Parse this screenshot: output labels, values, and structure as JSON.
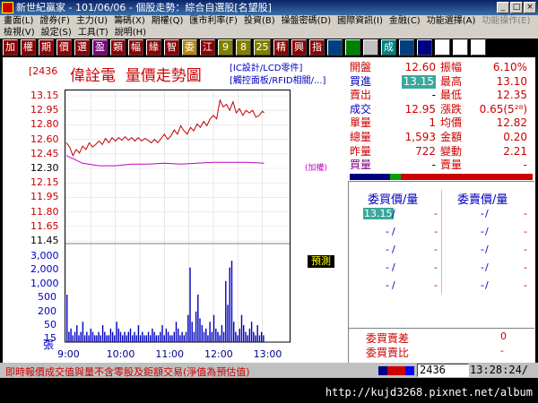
{
  "window": {
    "title": "新世紀贏家 - 101/06/06 - 個股走勢：綜合自選股[名望股]",
    "buttons": [
      "_",
      "□",
      "×"
    ]
  },
  "menu": {
    "row1": [
      {
        "label": "畫面(L)",
        "enabled": true
      },
      {
        "label": "證券(F)",
        "enabled": true
      },
      {
        "label": "主力(U)",
        "enabled": true
      },
      {
        "label": "籌碼(X)",
        "enabled": true
      },
      {
        "label": "期權(Q)",
        "enabled": true
      },
      {
        "label": "匯市利率(F)",
        "enabled": true
      },
      {
        "label": "投資(B)",
        "enabled": true
      },
      {
        "label": "操盤密碼(D)",
        "enabled": true
      },
      {
        "label": "國際資訊(I)",
        "enabled": true
      },
      {
        "label": "金融(C)",
        "enabled": true
      },
      {
        "label": "功能選擇(A)",
        "enabled": true
      },
      {
        "label": "功能操作(E)",
        "enabled": false
      }
    ],
    "row2": [
      {
        "label": "檢視(V)",
        "enabled": true
      },
      {
        "label": "設定(S)",
        "enabled": true
      },
      {
        "label": "工具(T)",
        "enabled": true
      },
      {
        "label": "說明(H)",
        "enabled": true
      }
    ]
  },
  "toolbar": {
    "buttons": [
      {
        "label": "加",
        "bg": "#8b0000",
        "fg": "#ffffff"
      },
      {
        "label": "權",
        "bg": "#8b0000",
        "fg": "#ffffff"
      },
      {
        "label": "期",
        "bg": "#8b0000",
        "fg": "#ffffff"
      },
      {
        "label": "價",
        "bg": "#8b0000",
        "fg": "#ffffff"
      },
      {
        "label": "選",
        "bg": "#8b0000",
        "fg": "#ffffff"
      },
      {
        "label": "盈",
        "bg": "#800080",
        "fg": "#ffffff"
      },
      {
        "label": "類",
        "bg": "#8b0000",
        "fg": "#ffffff"
      },
      {
        "label": "幅",
        "bg": "#8b0000",
        "fg": "#ffffff"
      },
      {
        "label": "緣",
        "bg": "#8b0000",
        "fg": "#ffffff"
      },
      {
        "label": "智",
        "bg": "#8b0000",
        "fg": "#ffffff"
      },
      {
        "label": "委",
        "bg": "#b8860b",
        "fg": "#ffffff"
      },
      {
        "label": "江",
        "bg": "#8b0000",
        "fg": "#ffffff"
      },
      {
        "label": "9",
        "bg": "#808000",
        "fg": "#ffffff"
      },
      {
        "label": "8",
        "bg": "#808000",
        "fg": "#ffffff"
      },
      {
        "label": "25",
        "bg": "#808000",
        "fg": "#ffffff"
      },
      {
        "label": "精",
        "bg": "#8b0000",
        "fg": "#ffffff"
      },
      {
        "label": "興",
        "bg": "#8b0000",
        "fg": "#ffffff"
      },
      {
        "label": "指",
        "bg": "#8b0000",
        "fg": "#ffffff"
      },
      {
        "label": "",
        "bg": "#004080",
        "fg": "#ffffff"
      },
      {
        "label": "",
        "bg": "#008000",
        "fg": "#ffffff"
      },
      {
        "label": "",
        "bg": "#c0c0c0",
        "fg": "#000000"
      },
      {
        "label": "成",
        "bg": "#008080",
        "fg": "#ffffff"
      },
      {
        "label": "",
        "bg": "#004080",
        "fg": "#ffffff"
      },
      {
        "label": "",
        "bg": "#000080",
        "fg": "#ffffff"
      },
      {
        "label": "",
        "bg": "#ffffff",
        "fg": "#000000"
      },
      {
        "label": "",
        "bg": "#ffffff",
        "fg": "#000000"
      },
      {
        "label": "",
        "bg": "#ffffff",
        "fg": "#000000"
      }
    ]
  },
  "stock": {
    "code": "[2436",
    "name": "偉詮電",
    "view": "量價走勢圖"
  },
  "info_links": [
    "[IC設計/LCD零件]",
    "[觸控面板/RFID相關/...]"
  ],
  "chart_data": {
    "type": "line",
    "x_ticks": [
      "9:00",
      "10:00",
      "11:00",
      "12:00",
      "13:00"
    ],
    "y_ticks": [
      {
        "label": "13.15",
        "kind": "up"
      },
      {
        "label": "12.95",
        "kind": "up"
      },
      {
        "label": "12.80",
        "kind": "up"
      },
      {
        "label": "12.60",
        "kind": "up"
      },
      {
        "label": "12.45",
        "kind": "up"
      },
      {
        "label": "12.30",
        "kind": "base"
      },
      {
        "label": "12.15",
        "kind": "up"
      },
      {
        "label": "11.95",
        "kind": "up"
      },
      {
        "label": "11.80",
        "kind": "up"
      },
      {
        "label": "11.65",
        "kind": "up"
      },
      {
        "label": "11.45",
        "kind": "base"
      }
    ],
    "volume_ticks": [
      "3,000",
      "2,000",
      "1,000",
      "500",
      "200",
      "50",
      "15"
    ],
    "volume_unit": "張",
    "ylim": [
      11.45,
      13.15
    ],
    "reference_label": "(加權)",
    "price_series": {
      "name": "price",
      "color": "#c00000",
      "points": [
        [
          0,
          12.6
        ],
        [
          4,
          12.55
        ],
        [
          8,
          12.45
        ],
        [
          12,
          12.52
        ],
        [
          16,
          12.48
        ],
        [
          20,
          12.56
        ],
        [
          24,
          12.52
        ],
        [
          28,
          12.6
        ],
        [
          32,
          12.55
        ],
        [
          36,
          12.58
        ],
        [
          40,
          12.62
        ],
        [
          44,
          12.58
        ],
        [
          48,
          12.65
        ],
        [
          52,
          12.6
        ],
        [
          56,
          12.66
        ],
        [
          60,
          12.62
        ],
        [
          64,
          12.66
        ],
        [
          68,
          12.63
        ],
        [
          72,
          12.67
        ],
        [
          76,
          12.63
        ],
        [
          80,
          12.66
        ],
        [
          84,
          12.62
        ],
        [
          88,
          12.66
        ],
        [
          92,
          12.62
        ],
        [
          96,
          12.65
        ],
        [
          100,
          12.63
        ],
        [
          104,
          12.6
        ],
        [
          108,
          12.64
        ],
        [
          112,
          12.6
        ],
        [
          116,
          12.65
        ],
        [
          120,
          12.7
        ],
        [
          124,
          12.64
        ],
        [
          128,
          12.68
        ],
        [
          132,
          12.75
        ],
        [
          136,
          12.7
        ],
        [
          140,
          12.8
        ],
        [
          144,
          12.74
        ],
        [
          148,
          12.7
        ],
        [
          152,
          12.78
        ],
        [
          156,
          12.74
        ],
        [
          160,
          12.82
        ],
        [
          164,
          12.78
        ],
        [
          168,
          12.85
        ],
        [
          172,
          12.8
        ],
        [
          176,
          12.88
        ],
        [
          180,
          12.92
        ],
        [
          184,
          12.88
        ],
        [
          188,
          13.1
        ],
        [
          192,
          13.02
        ],
        [
          196,
          13.05
        ],
        [
          200,
          12.98
        ],
        [
          204,
          13.08
        ],
        [
          208,
          12.95
        ],
        [
          212,
          13.0
        ],
        [
          216,
          12.92
        ],
        [
          220,
          12.98
        ],
        [
          224,
          12.95
        ],
        [
          228,
          12.98
        ],
        [
          232,
          12.9
        ],
        [
          236,
          12.92
        ],
        [
          240,
          12.97
        ],
        [
          242,
          12.95
        ]
      ]
    },
    "reference_series": {
      "name": "index",
      "color": "#c000c0",
      "points": [
        [
          0,
          12.45
        ],
        [
          20,
          12.36
        ],
        [
          40,
          12.33
        ],
        [
          60,
          12.33
        ],
        [
          80,
          12.35
        ],
        [
          100,
          12.35
        ],
        [
          120,
          12.36
        ],
        [
          140,
          12.35
        ],
        [
          160,
          12.36
        ],
        [
          180,
          12.37
        ],
        [
          200,
          12.37
        ],
        [
          220,
          12.37
        ],
        [
          242,
          12.36
        ]
      ]
    },
    "volume_series": [
      14,
      3,
      4,
      2,
      3,
      5,
      2,
      3,
      6,
      2,
      3,
      2,
      4,
      3,
      2,
      2,
      3,
      2,
      5,
      3,
      2,
      2,
      4,
      3,
      2,
      6,
      4,
      3,
      2,
      3,
      2,
      3,
      4,
      2,
      3,
      2,
      5,
      2,
      3,
      2,
      2,
      3,
      2,
      4,
      3,
      2,
      2,
      3,
      5,
      2,
      4,
      3,
      2,
      2,
      3,
      6,
      4,
      2,
      3,
      2,
      3,
      8,
      22,
      6,
      3,
      9,
      14,
      7,
      5,
      3,
      4,
      2,
      6,
      3,
      8,
      4,
      3,
      2,
      5,
      3,
      18,
      11,
      22,
      24,
      6,
      3,
      2,
      4,
      8,
      5,
      3,
      2,
      4,
      6,
      3,
      2,
      5,
      2,
      3,
      2
    ],
    "session_start": "9:00",
    "session_end": "13:30",
    "total_minutes": 270
  },
  "estimate_badge": "預測",
  "stats": [
    {
      "l": "開盤",
      "lc": "red",
      "v": "12.60",
      "l2": "振幅",
      "v2": "6.10%"
    },
    {
      "l": "買進",
      "lc": "blue",
      "v": "13.15",
      "vhl": true,
      "l2": "最高",
      "v2": "13.10"
    },
    {
      "l": "賣出",
      "lc": "red",
      "v": "-",
      "l2": "最低",
      "v2": "12.35"
    },
    {
      "l": "成交",
      "lc": "blue",
      "v": "12.95",
      "l2": "漲跌",
      "v2": "0.65(5²⁸)"
    },
    {
      "l": "單量",
      "lc": "red",
      "v": "1",
      "l2": "均價",
      "v2": "12.82"
    },
    {
      "l": "總量",
      "lc": "red",
      "v": "1,593",
      "l2": "金額",
      "v2": "0.20"
    },
    {
      "l": "昨量",
      "lc": "red",
      "v": "722",
      "l2": "變動",
      "v2": "2.21"
    },
    {
      "l": "買量",
      "lc": "purple",
      "v": "-",
      "l2": "賣量",
      "v2": "-"
    }
  ],
  "ratio_bar": [
    {
      "color": "#000080",
      "frac": 0.22
    },
    {
      "color": "#00a000",
      "frac": 0.06
    },
    {
      "color": "#cc0000",
      "frac": 0.72
    }
  ],
  "orderbook": {
    "bid_header": "委買價/量",
    "ask_header": "委賣價/量",
    "rows": [
      {
        "bid": "13.15",
        "bidhl": true,
        "bid_sep": "/",
        "bid_qty": "-",
        "ask": "-",
        "ask_sep": "/",
        "ask_qty": "-"
      },
      {
        "bid": "-",
        "bid_sep": "/",
        "bid_qty": "-",
        "ask": "-",
        "ask_sep": "/",
        "ask_qty": "-"
      },
      {
        "bid": "-",
        "bid_sep": "/",
        "bid_qty": "-",
        "ask": "-",
        "ask_sep": "/",
        "ask_qty": "-"
      },
      {
        "bid": "-",
        "bid_sep": "/",
        "bid_qty": "-",
        "ask": "-",
        "ask_sep": "/",
        "ask_qty": "-"
      },
      {
        "bid": "-",
        "bid_sep": "/",
        "bid_qty": "-",
        "ask": "-",
        "ask_sep": "/",
        "ask_qty": "-"
      }
    ],
    "diff_label": "委買賣差",
    "diff_value": "0",
    "ratio_label": "委買賣比",
    "ratio_value": "-"
  },
  "status": {
    "message": "即時報價成交值與量不含零股及鉅額交易(淨值為預估值)",
    "mini_colors": [
      "#000080",
      "#cc0000",
      "#cc0000",
      "#0000ff"
    ],
    "code_input": "2436",
    "clock": "13:28:24/"
  },
  "watermark": "http://kujd3268.pixnet.net/album"
}
